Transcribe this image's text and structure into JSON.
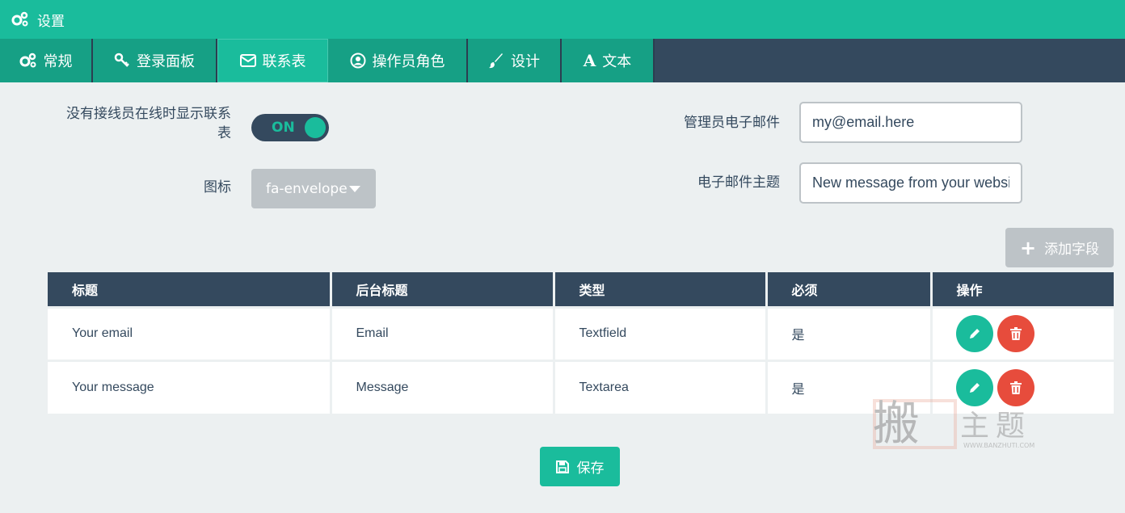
{
  "header": {
    "title": "设置",
    "icon": "gears-icon"
  },
  "tabs": [
    {
      "label": "常规",
      "icon": "gears-icon",
      "active": false
    },
    {
      "label": "登录面板",
      "icon": "key-icon",
      "active": false
    },
    {
      "label": "联系表",
      "icon": "envelope-icon",
      "active": true
    },
    {
      "label": "操作员角色",
      "icon": "user-circle-icon",
      "active": false
    },
    {
      "label": "设计",
      "icon": "paintbrush-icon",
      "active": false
    },
    {
      "label": "文本",
      "icon": "font-icon",
      "active": false
    }
  ],
  "form": {
    "show_contact_label_1": "没有接线员在线时显示联系",
    "show_contact_label_2": "表",
    "toggle_value": "ON",
    "icon_label": "图标",
    "icon_value": "fa-envelope",
    "admin_email_label": "管理员电子邮件",
    "admin_email_value": "my@email.here",
    "subject_label": "电子邮件主题",
    "subject_value": "New message from your website"
  },
  "add_field_label": "添加字段",
  "table": {
    "headers": [
      "标题",
      "后台标题",
      "类型",
      "必须",
      "操作"
    ],
    "rows": [
      {
        "title": "Your email",
        "backend": "Email",
        "type": "Textfield",
        "required": "是"
      },
      {
        "title": "Your message",
        "backend": "Message",
        "type": "Textarea",
        "required": "是"
      }
    ]
  },
  "save_label": "保存",
  "watermark": {
    "big": "搬",
    "text": "主题",
    "url": "WWW.BANZHUTI.COM"
  },
  "colors": {
    "primary": "#1abc9c",
    "dark": "#34495e",
    "danger": "#e74c3c",
    "muted": "#bdc3c7"
  }
}
